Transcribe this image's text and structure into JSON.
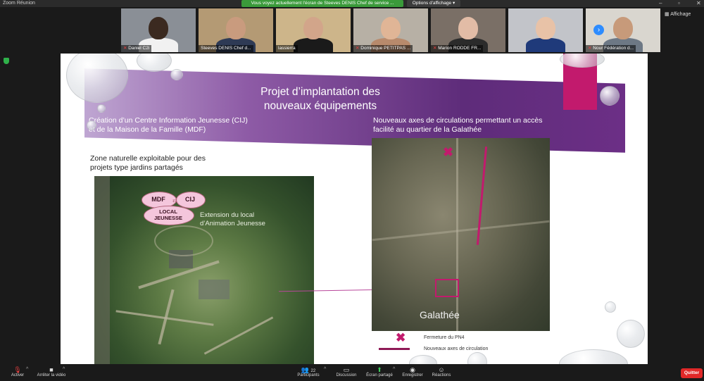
{
  "app": {
    "title": "Zoom Réunion"
  },
  "share_banner": "Vous voyez actuellement l'écran de Steeves DENIS Chef de service ...",
  "view_options": "Options d'affichage",
  "window_controls": {
    "minimize": "–",
    "maximize": "▫",
    "close": "✕"
  },
  "participants": [
    {
      "name": "Daniel C2i",
      "muted": true,
      "bg": "#8a8f96",
      "skin": "#3b2a20",
      "shirt": "#f1f1f1"
    },
    {
      "name": "Steeves DENIS Chef d...",
      "muted": false,
      "bg": "#b49a74",
      "skin": "#c99b7e",
      "shirt": "#2e3a55"
    },
    {
      "name": "lassierra",
      "muted": false,
      "bg": "#cdb58a",
      "skin": "#d2a58a",
      "shirt": "#1a1a1a"
    },
    {
      "name": "Dominique PETITPAS ...",
      "muted": true,
      "bg": "#b7b0a5",
      "skin": "#e0b596",
      "shirt": "#b88a6c"
    },
    {
      "name": "Marion RODDE FR...",
      "muted": true,
      "bg": "#7a6f66",
      "skin": "#e2bca6",
      "shirt": "#2b2b2b"
    },
    {
      "name": "",
      "muted": false,
      "bg": "#c2c4c9",
      "skin": "#e8c2a7",
      "shirt": "#1f3a7a"
    },
    {
      "name": "Nour Fédération d...",
      "muted": true,
      "bg": "#d9d6cf",
      "skin": "#c79a7a",
      "shirt": "#6d7885"
    }
  ],
  "gallery_next": "›",
  "affichage_label": "Affichage",
  "slide": {
    "title_line1": "Projet d’implantation des",
    "title_line2": "nouveaux équipements",
    "left_heading_line1": "Création d’un Centre Information Jeunesse (CIJ)",
    "left_heading_line2": "et de la Maison de la Famille (MDF)",
    "right_heading_line1": "Nouveaux axes de circulations permettant un accès",
    "right_heading_line2": "facilité au quartier de la Galathée",
    "zone_line1": "Zone naturelle exploitable pour des",
    "zone_line2": "projets type jardins partagés",
    "circle_mdf": "MDF",
    "circle_cij": "CIJ",
    "circle_local": "LOCAL",
    "circle_jeunesse": "JEUNESSE",
    "extension_line1": "Extension du local",
    "extension_line2": "d’Animation Jeunesse",
    "galathee_label": "Galathée",
    "legend_close_mark": "✖",
    "legend_close": "Fermeture du PN4",
    "legend_axes": "Nouveaux axes de circulation"
  },
  "toolbar": {
    "activer": "Activer",
    "arreter_video": "Arrêter la vidéo",
    "participants": "Participants",
    "participants_count": "22",
    "discussion": "Discussion",
    "ecran_partage": "Écran partagé",
    "enregistrer": "Enregistrer",
    "reactions": "Réactions",
    "quitter": "Quitter"
  },
  "colors": {
    "accent_green": "#3a9a3a",
    "zoom_blue": "#2d8cff",
    "slide_magenta": "#c21a6d",
    "banner_purple": "#5e2c7a",
    "quit_red": "#e02828"
  }
}
